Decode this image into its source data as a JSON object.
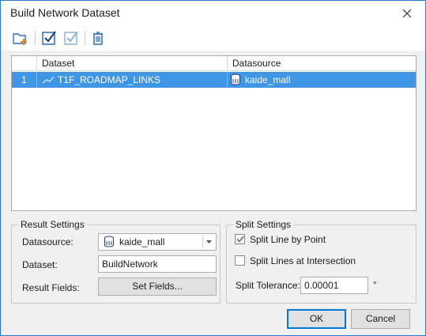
{
  "window": {
    "title": "Build Network Dataset",
    "close_icon": "close-icon"
  },
  "toolbar": {
    "buttons": [
      {
        "name": "add-folder-icon"
      },
      {
        "name": "select-all-icon"
      },
      {
        "name": "select-inverse-icon"
      },
      {
        "name": "delete-icon"
      }
    ]
  },
  "grid": {
    "columns": [
      "Dataset",
      "Datasource"
    ],
    "rows": [
      {
        "index": "1",
        "dataset": "T1F_ROADMAP_LINKS",
        "datasource": "kaide_mall"
      }
    ]
  },
  "result_settings": {
    "title": "Result Settings",
    "datasource_label": "Datasource:",
    "datasource_value": "kaide_mall",
    "dataset_label": "Dataset:",
    "dataset_value": "BuildNetwork",
    "fields_label": "Result Fields:",
    "fields_button": "Set Fields..."
  },
  "split_settings": {
    "title": "Split Settings",
    "split_by_point_label": "Split Line by Point",
    "split_by_point_checked": true,
    "split_at_intersection_label": "Split Lines at Intersection",
    "split_at_intersection_checked": false,
    "tolerance_label": "Split Tolerance:",
    "tolerance_value": "0.00001",
    "tolerance_unit": "°"
  },
  "footer": {
    "ok_label": "OK",
    "cancel_label": "Cancel"
  },
  "colors": {
    "selection": "#3f95e6",
    "accent": "#2b79d6"
  }
}
